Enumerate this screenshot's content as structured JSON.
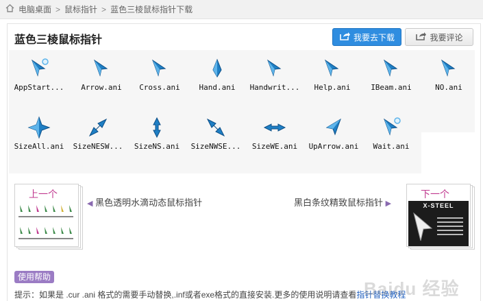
{
  "breadcrumb": {
    "items": [
      "电脑桌面",
      "鼠标指针",
      "蓝色三棱鼠标指针下载"
    ],
    "separator": ">"
  },
  "header": {
    "title": "蓝色三棱鼠标指针",
    "download_label": "我要去下载",
    "comment_label": "我要评论"
  },
  "cursors": [
    {
      "label": "AppStart...",
      "icon": "app-start-cursor"
    },
    {
      "label": "Arrow.ani",
      "icon": "arrow-cursor"
    },
    {
      "label": "Cross.ani",
      "icon": "cross-cursor"
    },
    {
      "label": "Hand.ani",
      "icon": "hand-cursor"
    },
    {
      "label": "Handwrit...",
      "icon": "handwriting-cursor"
    },
    {
      "label": "Help.ani",
      "icon": "help-cursor"
    },
    {
      "label": "IBeam.ani",
      "icon": "ibeam-cursor"
    },
    {
      "label": "NO.ani",
      "icon": "no-cursor"
    },
    {
      "label": "SizeAll.ani",
      "icon": "size-all-cursor"
    },
    {
      "label": "SizeNESW...",
      "icon": "size-nesw-cursor"
    },
    {
      "label": "SizeNS.ani",
      "icon": "size-ns-cursor"
    },
    {
      "label": "SizeNWSE...",
      "icon": "size-nwse-cursor"
    },
    {
      "label": "SizeWE.ani",
      "icon": "size-we-cursor"
    },
    {
      "label": "UpArrow.ani",
      "icon": "up-arrow-cursor"
    },
    {
      "label": "Wait.ani",
      "icon": "wait-cursor"
    }
  ],
  "prev": {
    "badge": "上一个",
    "title": "黑色透明水滴动态鼠标指针"
  },
  "next": {
    "badge": "下一个",
    "title": "黑白条纹精致鼠标指针",
    "thumb_text": "X-STEEL"
  },
  "help": {
    "tag": "使用帮助",
    "tip_text": "提示：如果是 .cur .ani 格式的需要手动替换,.inf或者exe格式的直接安装.更多的使用说明请查看",
    "tip_link": "指针替换教程"
  },
  "watermark": "Baidu 经验",
  "colors": {
    "accent": "#2f8de0",
    "cursor_blue": "#1f7fc4",
    "help_tag": "#9b7cc4",
    "badge_pink": "#c0398f"
  }
}
